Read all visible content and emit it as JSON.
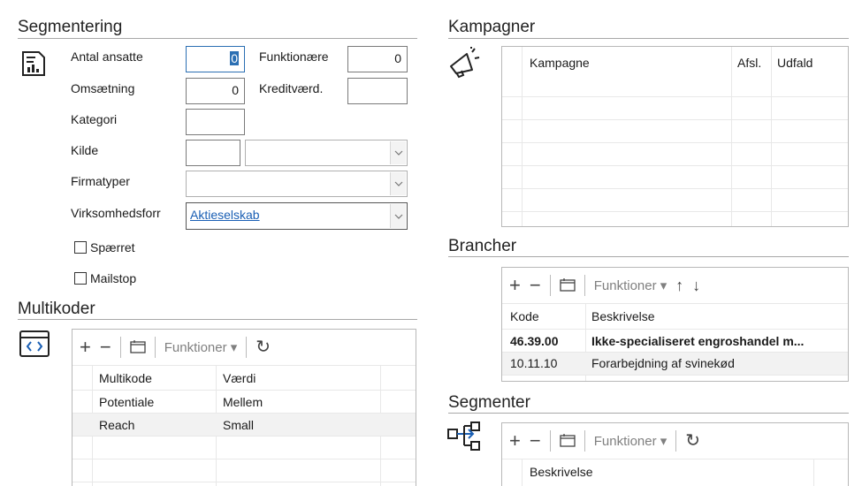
{
  "segmentering": {
    "title": "Segmentering",
    "antal_ansatte_label": "Antal ansatte",
    "antal_ansatte_value": "0",
    "funktionaere_label": "Funktionære",
    "funktionaere_value": "0",
    "omsaetning_label": "Omsætning",
    "omsaetning_value": "0",
    "kreditvaerd_label": "Kreditværd.",
    "kreditvaerd_value": "",
    "kategori_label": "Kategori",
    "kategori_value": "",
    "kilde_label": "Kilde",
    "kilde_value": "",
    "kilde_select_value": "",
    "firmatyper_label": "Firmatyper",
    "firmatyper_value": "",
    "virksomhedsforr_label": "Virksomhedsforr",
    "virksomhedsforr_value": "Aktieselskab",
    "spaerret_label": "Spærret",
    "mailstop_label": "Mailstop"
  },
  "multikoder": {
    "title": "Multikoder",
    "functions_label": "Funktioner",
    "columns": [
      "Multikode",
      "Værdi"
    ],
    "rows": [
      {
        "kode": "Potentiale",
        "vaerdi": "Mellem"
      },
      {
        "kode": "Reach",
        "vaerdi": "Small"
      }
    ]
  },
  "kampagner": {
    "title": "Kampagner",
    "columns": [
      "Kampagne",
      "Afsl.",
      "Udfald"
    ]
  },
  "brancher": {
    "title": "Brancher",
    "functions_label": "Funktioner",
    "columns": [
      "Kode",
      "Beskrivelse"
    ],
    "rows": [
      {
        "kode": "46.39.00",
        "beskrivelse": "Ikke-specialiseret engroshandel m..."
      },
      {
        "kode": "10.11.10",
        "beskrivelse": "Forarbejdning af svinekød"
      }
    ]
  },
  "segmenter": {
    "title": "Segmenter",
    "functions_label": "Funktioner",
    "columns": [
      "Beskrivelse"
    ]
  },
  "colors": {
    "link": "#1a5fb4",
    "focus_border": "#2b6fb3",
    "selected_row": "#f2f2f2"
  }
}
